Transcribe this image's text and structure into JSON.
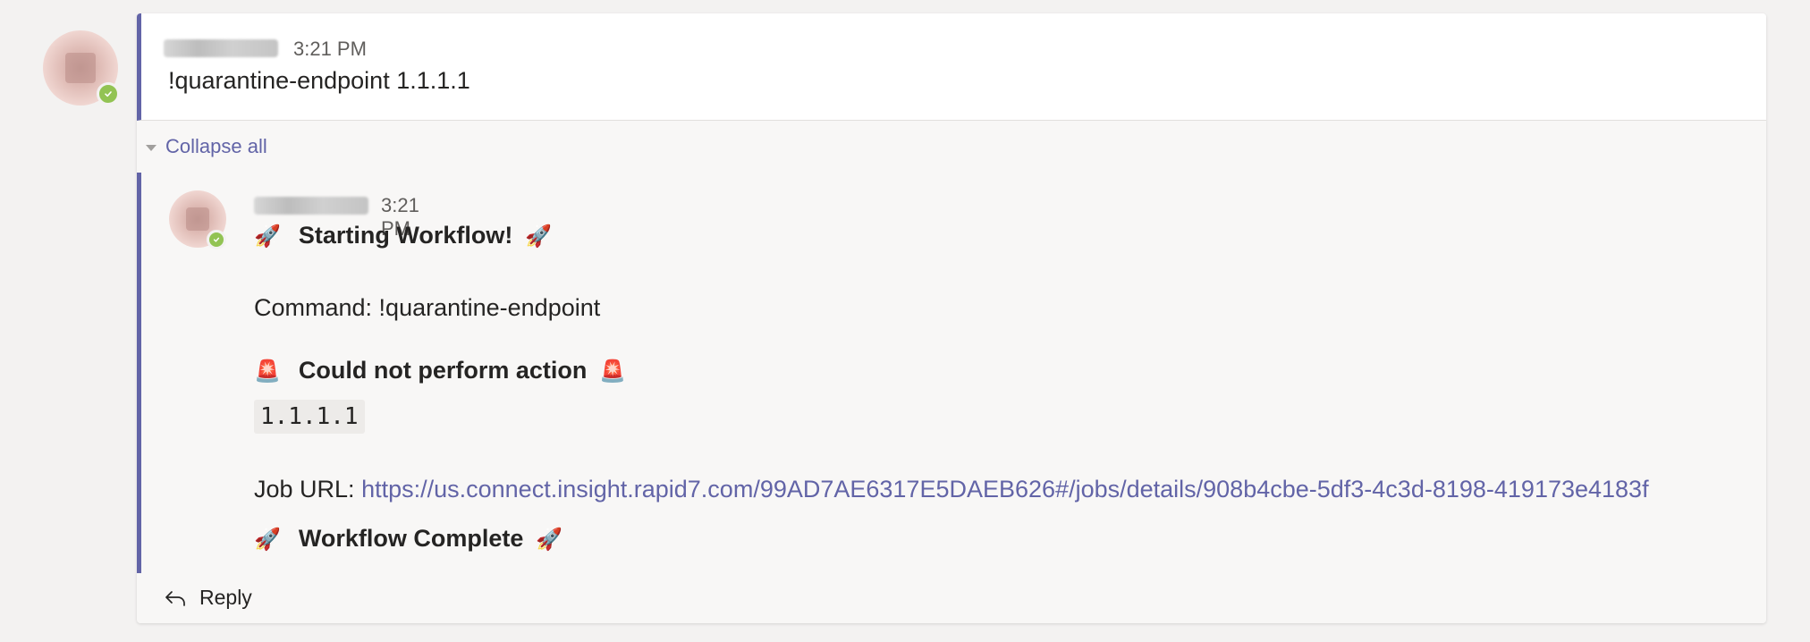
{
  "root_message": {
    "time": "3:21 PM",
    "text": "!quarantine-endpoint 1.1.1.1"
  },
  "collapse_label": "Collapse all",
  "reply_message": {
    "time": "3:21 PM",
    "starting_workflow": "Starting Workflow!",
    "command_line": "Command: !quarantine-endpoint",
    "error_heading": "Could not perform action",
    "error_value": "1.1.1.1",
    "job_url_label": "Job URL:",
    "job_url": "https://us.connect.insight.rapid7.com/99AD7AE6317E5DAEB626#/jobs/details/908b4cbe-5df3-4c3d-8198-419173e4183f",
    "workflow_complete": "Workflow Complete"
  },
  "reply_button_label": "Reply",
  "icons": {
    "rocket": "🚀",
    "siren": "🚨"
  },
  "colors": {
    "accent": "#6264a7",
    "presence_available": "#92c353",
    "background": "#f3f2f1"
  }
}
